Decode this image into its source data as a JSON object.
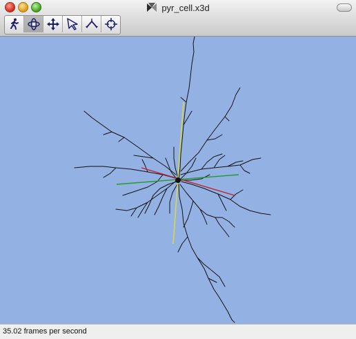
{
  "window": {
    "title": "pyr_cell.x3d",
    "doc_icon": "x3d-file-icon"
  },
  "toolbar": {
    "tools": [
      {
        "name": "walk",
        "icon": "walk-icon",
        "active": false
      },
      {
        "name": "examine",
        "icon": "examine-icon",
        "active": true
      },
      {
        "name": "pan",
        "icon": "pan-arrows-icon",
        "active": false
      },
      {
        "name": "select",
        "icon": "select-pointer-icon",
        "active": false
      },
      {
        "name": "fly",
        "icon": "fly-icon",
        "active": false
      },
      {
        "name": "look-at",
        "icon": "crosshair-icon",
        "active": false
      }
    ]
  },
  "status": {
    "text": "35.02 frames per second"
  },
  "colors": {
    "viewport_bg": "#94b1e4",
    "axis_x": "#c0202c",
    "axis_y": "#d7d64a",
    "axis_z": "#1f9c2b",
    "neuron": "#111111"
  }
}
